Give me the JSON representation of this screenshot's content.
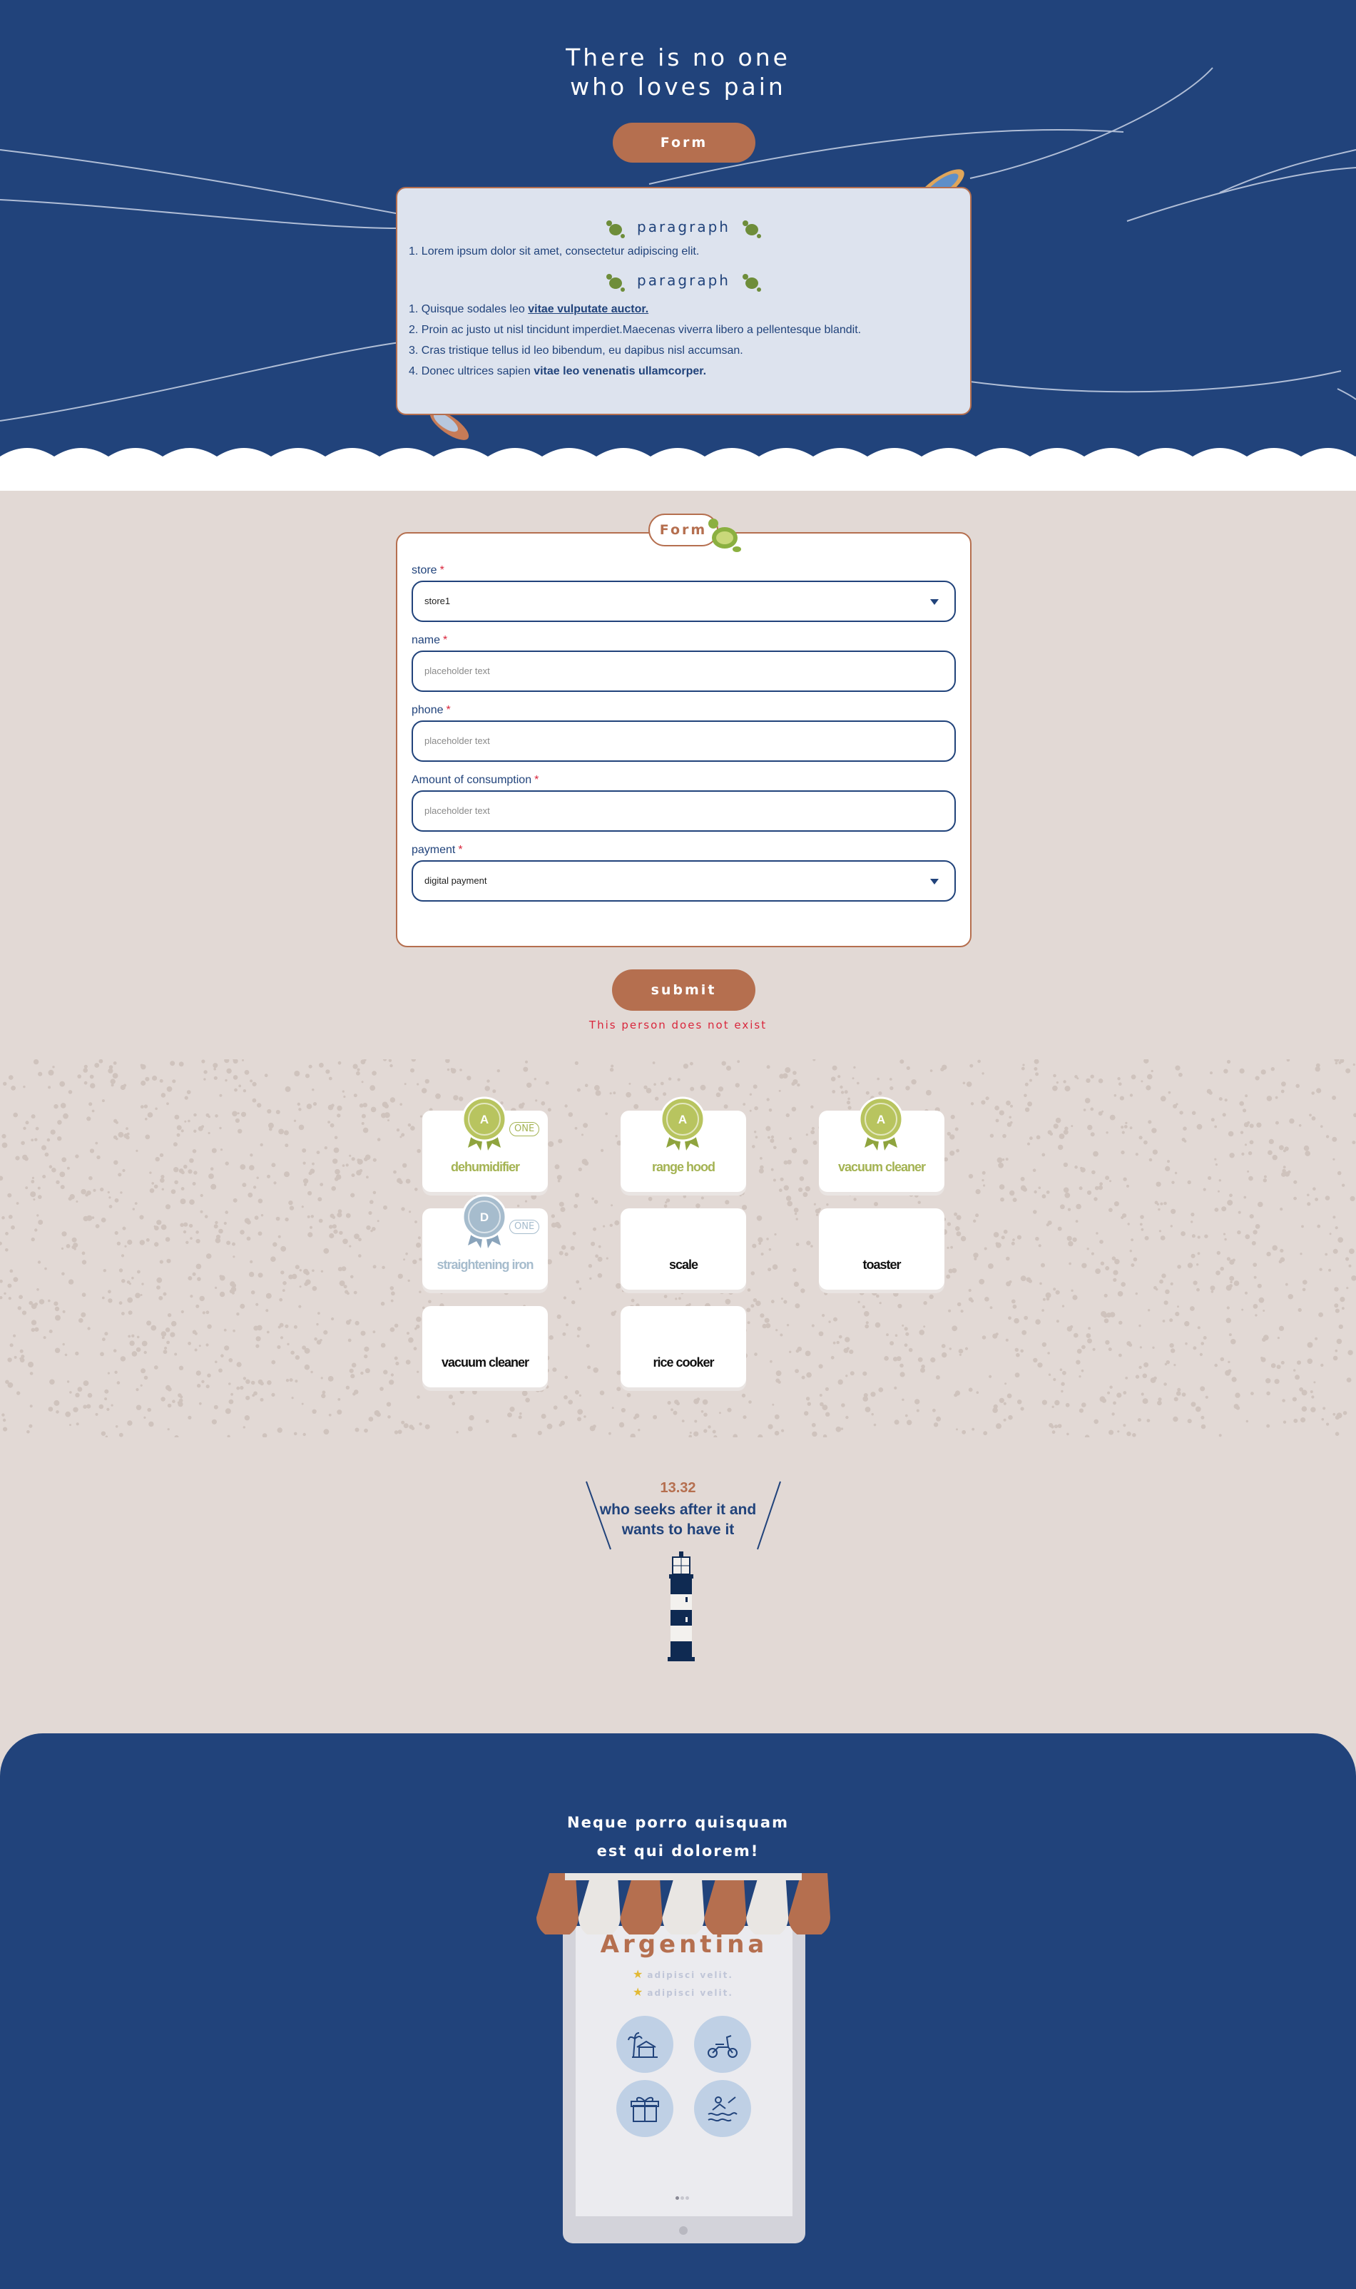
{
  "hero": {
    "title_line1": "There is no one",
    "title_line2": "who loves pain",
    "button_label": "Form"
  },
  "paragraph_card": {
    "heading1": "paragraph",
    "list1": [
      "1. Lorem ipsum dolor sit amet, consectetur adipiscing elit."
    ],
    "heading2": "paragraph",
    "list2": [
      {
        "prefix": "1. Quisque sodales leo ",
        "emph": "vitae vulputate auctor.",
        "suffix": ""
      },
      {
        "prefix": "2. Proin ac justo ut nisl tincidunt imperdiet.Maecenas viverra libero a pellentesque blandit.",
        "emph": "",
        "suffix": ""
      },
      {
        "prefix": "3. Cras tristique tellus id leo bibendum, eu dapibus nisl accumsan.",
        "emph": "",
        "suffix": ""
      },
      {
        "prefix": "4. Donec ultrices sapien ",
        "emph": "vitae leo venenatis ullamcorper.",
        "suffix": ""
      }
    ]
  },
  "form": {
    "tab_label": "Form",
    "fields": {
      "store": {
        "label": "store",
        "required": "*",
        "value": "store1"
      },
      "name": {
        "label": "name",
        "required": "*",
        "placeholder": "placeholder text"
      },
      "phone": {
        "label": "phone",
        "required": "*",
        "placeholder": "placeholder text"
      },
      "amount": {
        "label": "Amount of consumption",
        "required": "*",
        "placeholder": "placeholder text"
      },
      "payment": {
        "label": "payment",
        "required": "*",
        "value": "digital payment"
      }
    },
    "submit_label": "submit",
    "error_text": "This person does not exist"
  },
  "products": [
    {
      "label": "dehumidifier",
      "medal": "A",
      "tag": "ONE",
      "style": "green"
    },
    {
      "label": "range hood",
      "medal": "A",
      "tag": "",
      "style": "green"
    },
    {
      "label": "vacuum cleaner",
      "medal": "A",
      "tag": "",
      "style": "green"
    },
    {
      "label": "straightening iron",
      "medal": "D",
      "tag": "ONE",
      "style": "blue"
    },
    {
      "label": "scale",
      "medal": "",
      "tag": "",
      "style": "plain"
    },
    {
      "label": "toaster",
      "medal": "",
      "tag": "",
      "style": "plain"
    },
    {
      "label": "vacuum cleaner",
      "medal": "",
      "tag": "",
      "style": "plain"
    },
    {
      "label": "rice cooker",
      "medal": "",
      "tag": "",
      "style": "plain"
    }
  ],
  "lighthouse": {
    "number": "13.32",
    "line1": "who seeks after it and",
    "line2": "wants to have it"
  },
  "footer": {
    "title_line1": "Neque porro quisquam",
    "title_line2": "est qui dolorem!",
    "country": "Argentina",
    "ratings": [
      "adipisci velit.",
      "adipisci velit."
    ],
    "icons": [
      "beach-house-icon",
      "scooter-icon",
      "gift-icon",
      "swimming-icon"
    ]
  },
  "colors": {
    "navy": "#21437b",
    "terracotta": "#b56f4f",
    "sand": "#e2d9d5",
    "green": "#a4b353",
    "light_blue": "#a6bccd",
    "error": "#d9263c"
  }
}
